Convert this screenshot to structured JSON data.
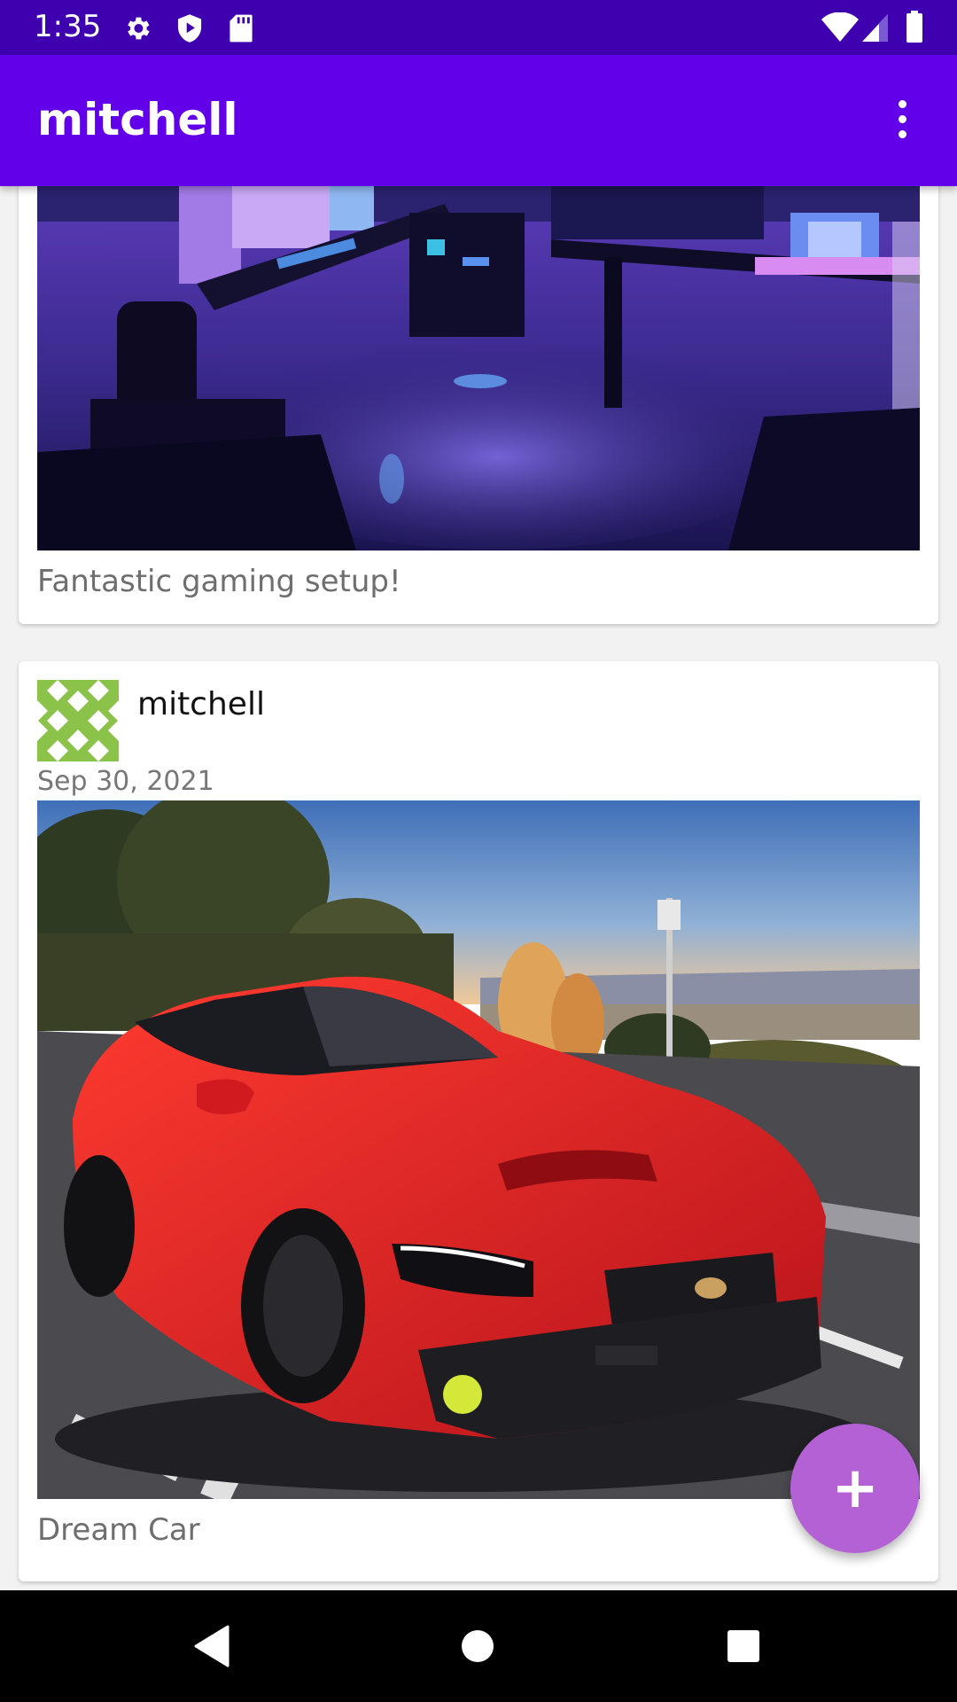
{
  "status_bar": {
    "time": "1:35",
    "icons": [
      "settings-icon",
      "shield-play-icon",
      "sd-card-icon",
      "wifi-icon",
      "cellular-icon",
      "battery-icon"
    ]
  },
  "app_bar": {
    "title": "mitchell",
    "menu_icon": "more-vert-icon"
  },
  "posts": [
    {
      "image": "gaming setup room with purple and blue lighting",
      "caption": "Fantastic gaming setup!"
    },
    {
      "author": "mitchell",
      "avatar": "green-identicon",
      "date": "Sep 30, 2021",
      "image": "red sports car on hilltop road at sunset",
      "caption": "Dream Car"
    }
  ],
  "fab": {
    "glyph": "+",
    "icon": "add-icon"
  },
  "nav_bar": {
    "buttons": [
      "back-icon",
      "home-icon",
      "recents-icon"
    ]
  },
  "colors": {
    "status_bar": "#3f00b0",
    "app_bar": "#6200ea",
    "fab": "#b561d6",
    "avatar_green": "#8bc34a"
  }
}
